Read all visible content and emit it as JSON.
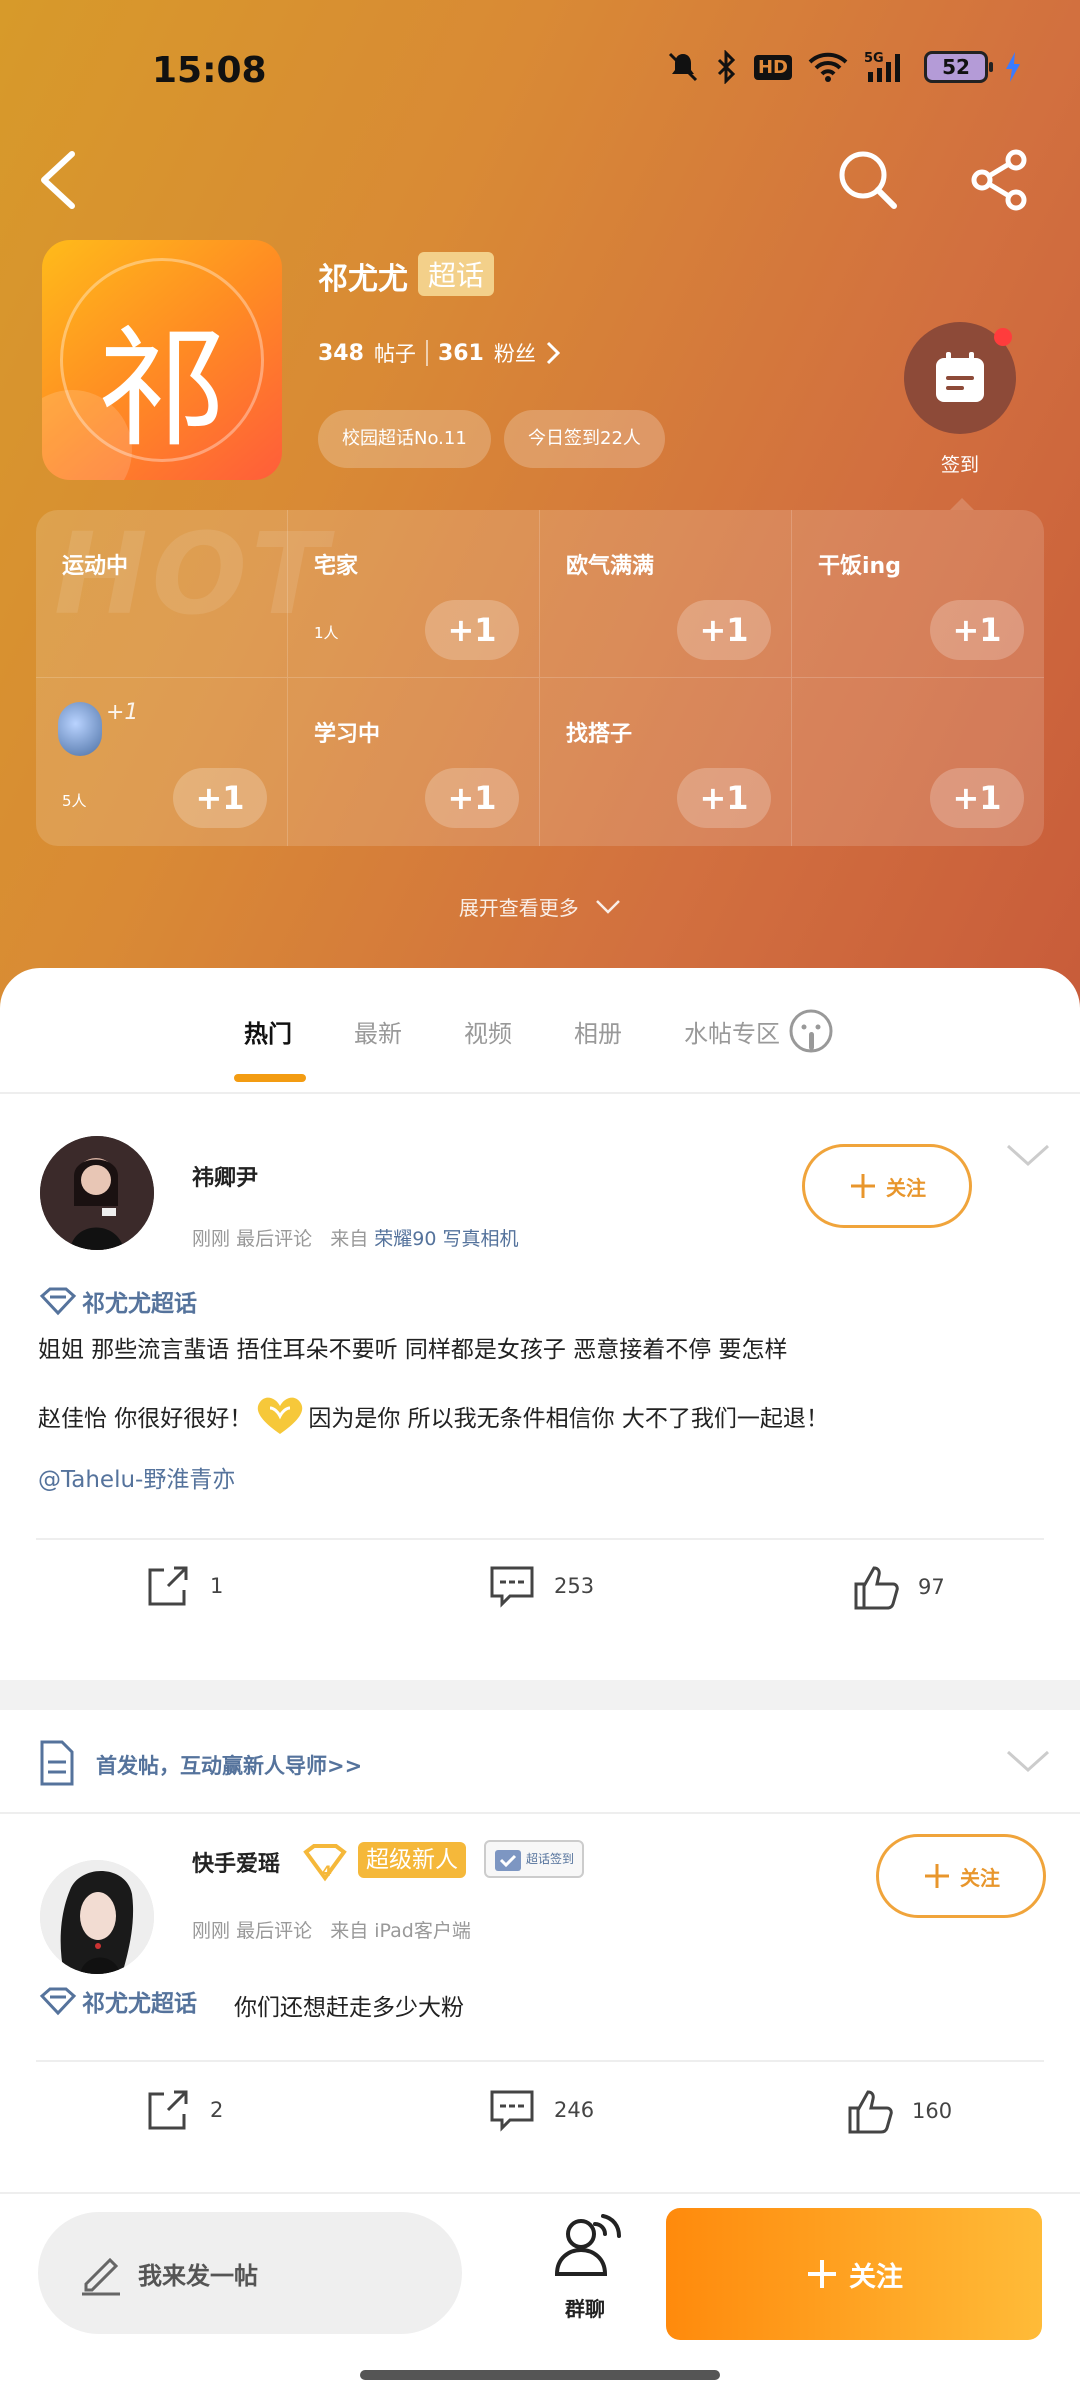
{
  "status": {
    "time": "15:08",
    "battery": "52",
    "network": "5G",
    "hd": "HD"
  },
  "topic": {
    "logo_char": "祁",
    "name": "祁尤尤",
    "tag": "超话",
    "posts_count": "348",
    "posts_label": "帖子",
    "fans_count": "361",
    "fans_label": "粉丝",
    "rank_pill": "校园超话No.11",
    "checkin_pill": "今日签到22人",
    "checkin_label": "签到"
  },
  "status_grid": {
    "watermark": "HOT",
    "plus_label": "+1",
    "cells": [
      {
        "label": "运动中",
        "count": "",
        "avatar_plus": "+1"
      },
      {
        "label": "宅家",
        "count": "1人"
      },
      {
        "label": "欧气满满",
        "count": ""
      },
      {
        "label": "干饭ing",
        "count": ""
      },
      {
        "label": "",
        "count": "5人"
      },
      {
        "label": "学习中",
        "count": ""
      },
      {
        "label": "找搭子",
        "count": ""
      },
      {
        "label": "",
        "count": ""
      }
    ]
  },
  "expand_label": "展开查看更多",
  "tabs": [
    "热门",
    "最新",
    "视频",
    "相册",
    "水帖专区"
  ],
  "posts": [
    {
      "username": "祎卿尹",
      "time": "刚刚",
      "last_comment": "最后评论",
      "from_label": "来自",
      "device": "荣耀90 写真相机",
      "follow_label": "关注",
      "topic_tag": "祁尤尤超话",
      "line1": "姐姐 那些流言蜚语 捂住耳朵不要听 同样都是女孩子 恶意接着不停 要怎样",
      "line2a": "赵佳怡 你很好很好！",
      "line2b": "因为是你 所以我无条件相信你 大不了我们一起退！",
      "mention": "@Tahelu-野淮青亦",
      "shares": "1",
      "comments": "253",
      "likes": "97"
    },
    {
      "username": "快手爱瑶",
      "badge_new": "超级新人",
      "badge_checkin": "超话签到",
      "time": "刚刚",
      "last_comment": "最后评论",
      "from_label": "来自",
      "device": "iPad客户端",
      "follow_label": "关注",
      "topic_tag": "祁尤尤超话",
      "text": "你们还想赶走多少大粉",
      "shares": "2",
      "comments": "246",
      "likes": "160"
    }
  ],
  "notice": "首发帖，互动赢新人导师>>",
  "bottom": {
    "compose_label": "我来发一帖",
    "groupchat_label": "群聊",
    "follow_label": "关注"
  },
  "colors": {
    "accent": "#f39c12",
    "link": "#55739c",
    "hero_start": "#d79a2a",
    "hero_end": "#c85c3a"
  }
}
